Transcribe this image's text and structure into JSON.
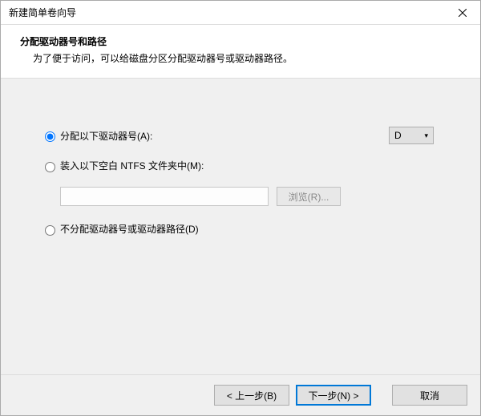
{
  "window": {
    "title": "新建简单卷向导"
  },
  "header": {
    "title": "分配驱动器号和路径",
    "subtitle": "为了便于访问，可以给磁盘分区分配驱动器号或驱动器路径。"
  },
  "options": {
    "assign_letter": {
      "label": "分配以下驱动器号(A):",
      "selected": true,
      "drive": "D"
    },
    "mount_folder": {
      "label": "装入以下空白 NTFS 文件夹中(M):",
      "selected": false,
      "path": "",
      "browse_label": "浏览(R)..."
    },
    "no_assign": {
      "label": "不分配驱动器号或驱动器路径(D)",
      "selected": false
    }
  },
  "buttons": {
    "back": "< 上一步(B)",
    "next": "下一步(N) >",
    "cancel": "取消"
  }
}
